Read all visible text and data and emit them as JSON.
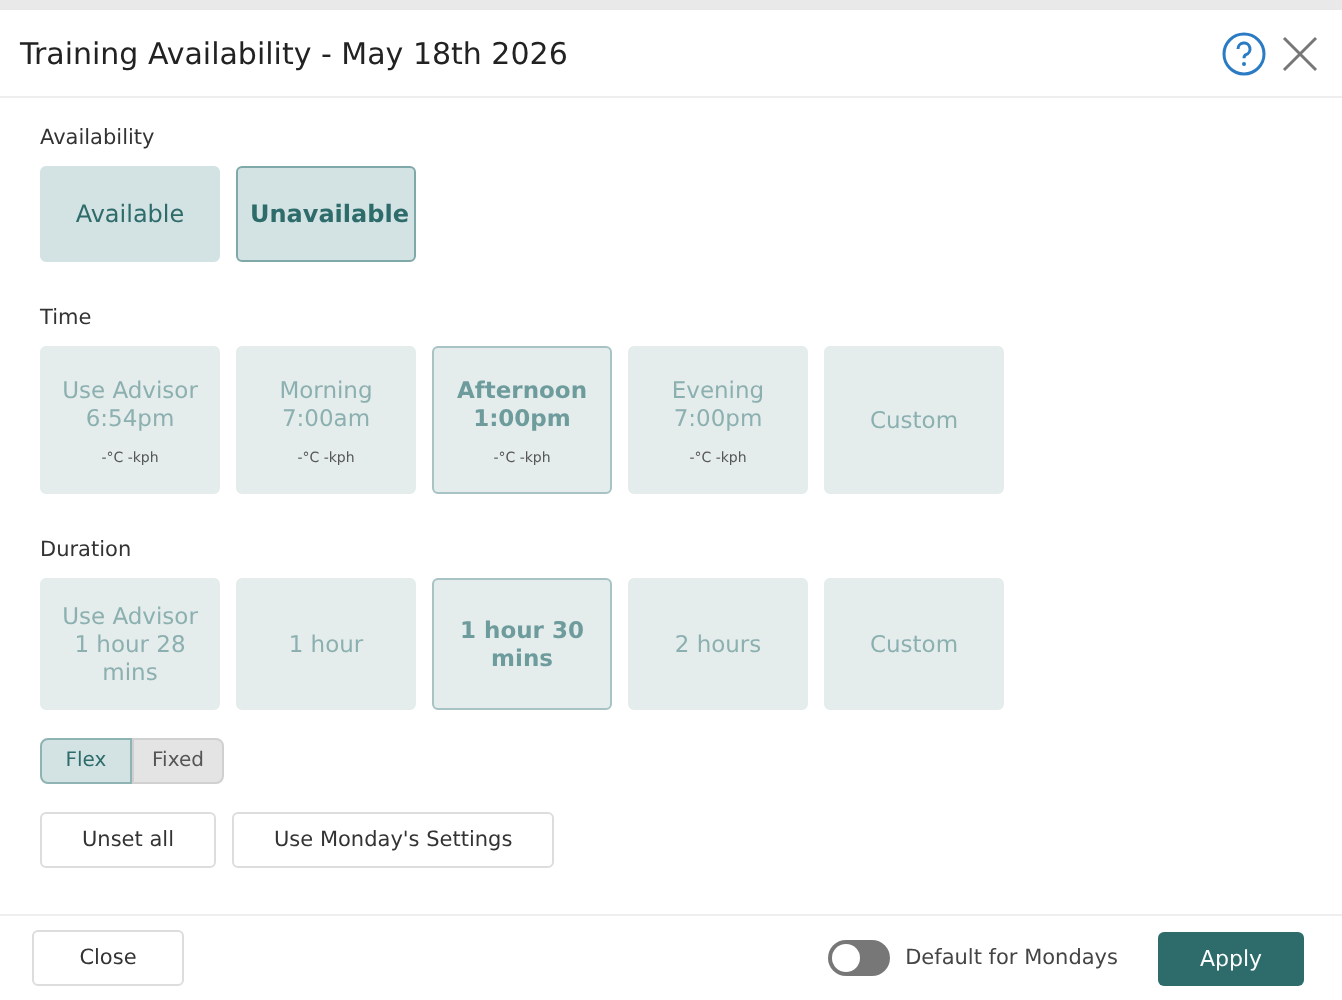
{
  "dialog": {
    "title": "Training Availability - May 18th 2026"
  },
  "availability": {
    "label": "Availability",
    "options": [
      {
        "label": "Available",
        "selected": false
      },
      {
        "label": "Unavailable",
        "selected": true
      }
    ]
  },
  "time": {
    "label": "Time",
    "options": [
      {
        "lines": [
          "Use Advisor",
          "6:54pm"
        ],
        "weather": "-°C -kph",
        "selected": false
      },
      {
        "lines": [
          "Morning",
          "7:00am"
        ],
        "weather": "-°C -kph",
        "selected": false
      },
      {
        "lines": [
          "Afternoon",
          "1:00pm"
        ],
        "weather": "-°C -kph",
        "selected": true
      },
      {
        "lines": [
          "Evening",
          "7:00pm"
        ],
        "weather": "-°C -kph",
        "selected": false
      },
      {
        "lines": [
          "Custom"
        ],
        "selected": false
      }
    ]
  },
  "duration": {
    "label": "Duration",
    "options": [
      {
        "lines": [
          "Use Advisor",
          "1 hour 28",
          "mins"
        ],
        "selected": false
      },
      {
        "lines": [
          "1 hour"
        ],
        "selected": false
      },
      {
        "lines": [
          "1 hour 30",
          "mins"
        ],
        "selected": true
      },
      {
        "lines": [
          "2 hours"
        ],
        "selected": false
      },
      {
        "lines": [
          "Custom"
        ],
        "selected": false
      }
    ]
  },
  "mode": [
    {
      "label": "Flex",
      "selected": true
    },
    {
      "label": "Fixed",
      "selected": false
    }
  ],
  "actions": [
    "Unset all",
    "Use Monday's Settings"
  ],
  "footer": {
    "close": "Close",
    "default_toggle": {
      "label": "Default for Mondays",
      "on": false
    },
    "apply": "Apply"
  }
}
